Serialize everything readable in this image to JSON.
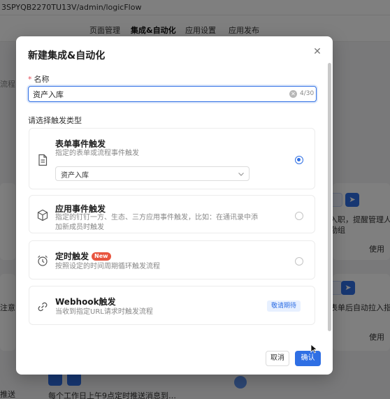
{
  "browser": {
    "url": "3SPYQB2270TU13V/admin/logicFlow"
  },
  "background": {
    "nav_tabs": [
      {
        "label": "页面管理"
      },
      {
        "label": "集成&自动化"
      },
      {
        "label": "应用设置"
      },
      {
        "label": "应用发布"
      }
    ],
    "left_fragment": "流程の",
    "left_fragment_2": "注意",
    "card_text_1": "入职，提醒管理人员",
    "card_text_1b": "勤组",
    "card_action_1": "使用",
    "card_text_2": "表单后自动拉入指定",
    "card_action_2": "使用",
    "bottom_text": "每个工作日上午9点定时推送消息到…",
    "bottom_left": "推送"
  },
  "modal": {
    "title": "新建集成&自动化",
    "close_icon": "close-icon",
    "name_label": "名称",
    "name_value": "资产入库",
    "name_counter": "4/30",
    "trigger_section_label": "请选择触发类型",
    "triggers": [
      {
        "title": "表单事件触发",
        "desc": "指定的表单或流程事件触发",
        "icon": "document-icon",
        "selected": true,
        "form_select_value": "资产入库"
      },
      {
        "title": "应用事件触发",
        "desc": "指定的钉钉一方、生态、三方应用事件触发，比如：在通讯录中添加新成员时触发",
        "icon": "cube-icon",
        "selected": false
      },
      {
        "title": "定时触发",
        "badge": "New",
        "desc": "按照设定的时间周期循环触发流程",
        "icon": "alarm-clock-icon",
        "selected": false
      },
      {
        "title": "Webhook触发",
        "desc": "当收到指定URL请求时触发流程",
        "icon": "link-icon",
        "status": "敬请期待"
      }
    ],
    "cancel_label": "取消",
    "confirm_label": "确认"
  },
  "colors": {
    "primary": "#2f6fe4",
    "overlay": "rgba(0,0,0,0.5)",
    "new_badge": "#e8553f"
  }
}
